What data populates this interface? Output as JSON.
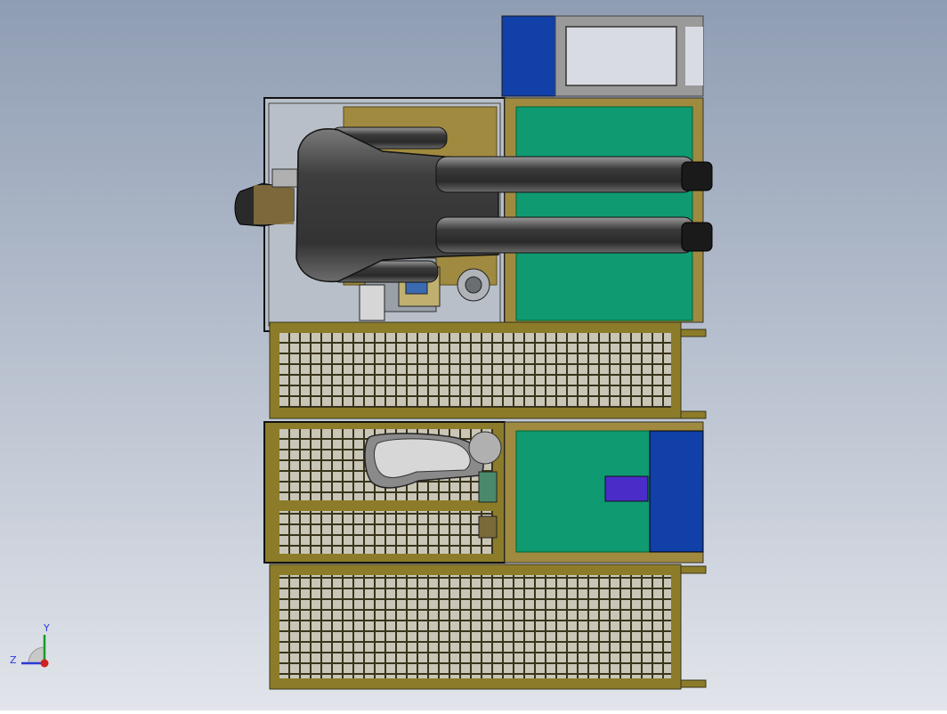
{
  "viewport": {
    "background_top": "#8f9db3",
    "background_bottom": "#e1e4ea"
  },
  "colors": {
    "mesh_frame": "#8c7c2a",
    "mesh_grid": "#3a341a",
    "mesh_fill": "#c9c6b8",
    "green_panel": "#0f9a72",
    "blue_panel": "#1040a8",
    "purple_box": "#4a2cc8",
    "gray_frame": "#9a9a9a",
    "robot_dark": "#3c3c3c",
    "robot_light": "#8a8a8a",
    "wood": "#a08a40"
  },
  "triad": {
    "y_label": "Y",
    "z_label": "Z",
    "x_axis_color": "#d02020",
    "y_axis_color": "#1a9a2a",
    "z_axis_color": "#2a3ad8"
  }
}
